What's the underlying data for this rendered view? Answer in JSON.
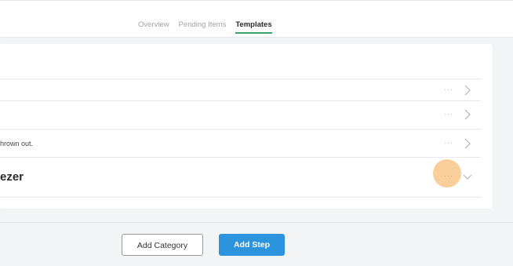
{
  "tabs": [
    {
      "label": "Overview",
      "active": false
    },
    {
      "label": "Pending Items",
      "active": false
    },
    {
      "label": "Templates",
      "active": true
    }
  ],
  "rows": [
    {
      "text": "",
      "menu": "···"
    },
    {
      "text": "",
      "menu": "···"
    },
    {
      "text": "hrown out.",
      "menu": "···"
    },
    {
      "text": "ezer",
      "menu": "···"
    }
  ],
  "buttons": {
    "add_category": "Add Category",
    "add_step": "Add Step"
  },
  "colors": {
    "accent_green": "#3aa36a",
    "primary_blue": "#2b94dc",
    "highlight_orange": "#f9c58a"
  }
}
